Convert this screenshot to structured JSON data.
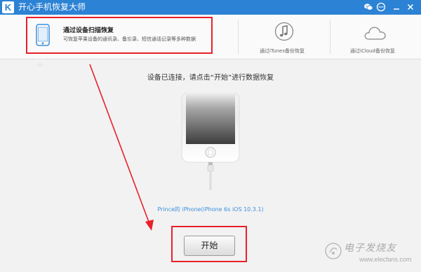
{
  "titlebar": {
    "logo_letter": "K",
    "title": "开心手机恢复大师"
  },
  "tabs": [
    {
      "title": "通过设备扫描恢复",
      "description": "可恢复苹果设备的通讯录、备忘录、短信通话记录等多种数据",
      "icon": "phone-icon",
      "active": true
    },
    {
      "caption": "通过iTunes备份恢复",
      "icon": "music-note-icon",
      "active": false
    },
    {
      "caption": "通过iCloud备份恢复",
      "icon": "cloud-icon",
      "active": false
    }
  ],
  "main": {
    "instruction": "设备已连接，请点击“开始”进行数据恢复",
    "device_info": "Prince的 iPhone(iPhone 6s iOS 10.3.1)",
    "start_label": "开始"
  },
  "watermark": {
    "text": "电子发烧友",
    "url": "www.elecfans.com"
  },
  "colors": {
    "titlebar": "#2c82d4",
    "annotation": "#e8202a",
    "link": "#3a8fdc"
  }
}
